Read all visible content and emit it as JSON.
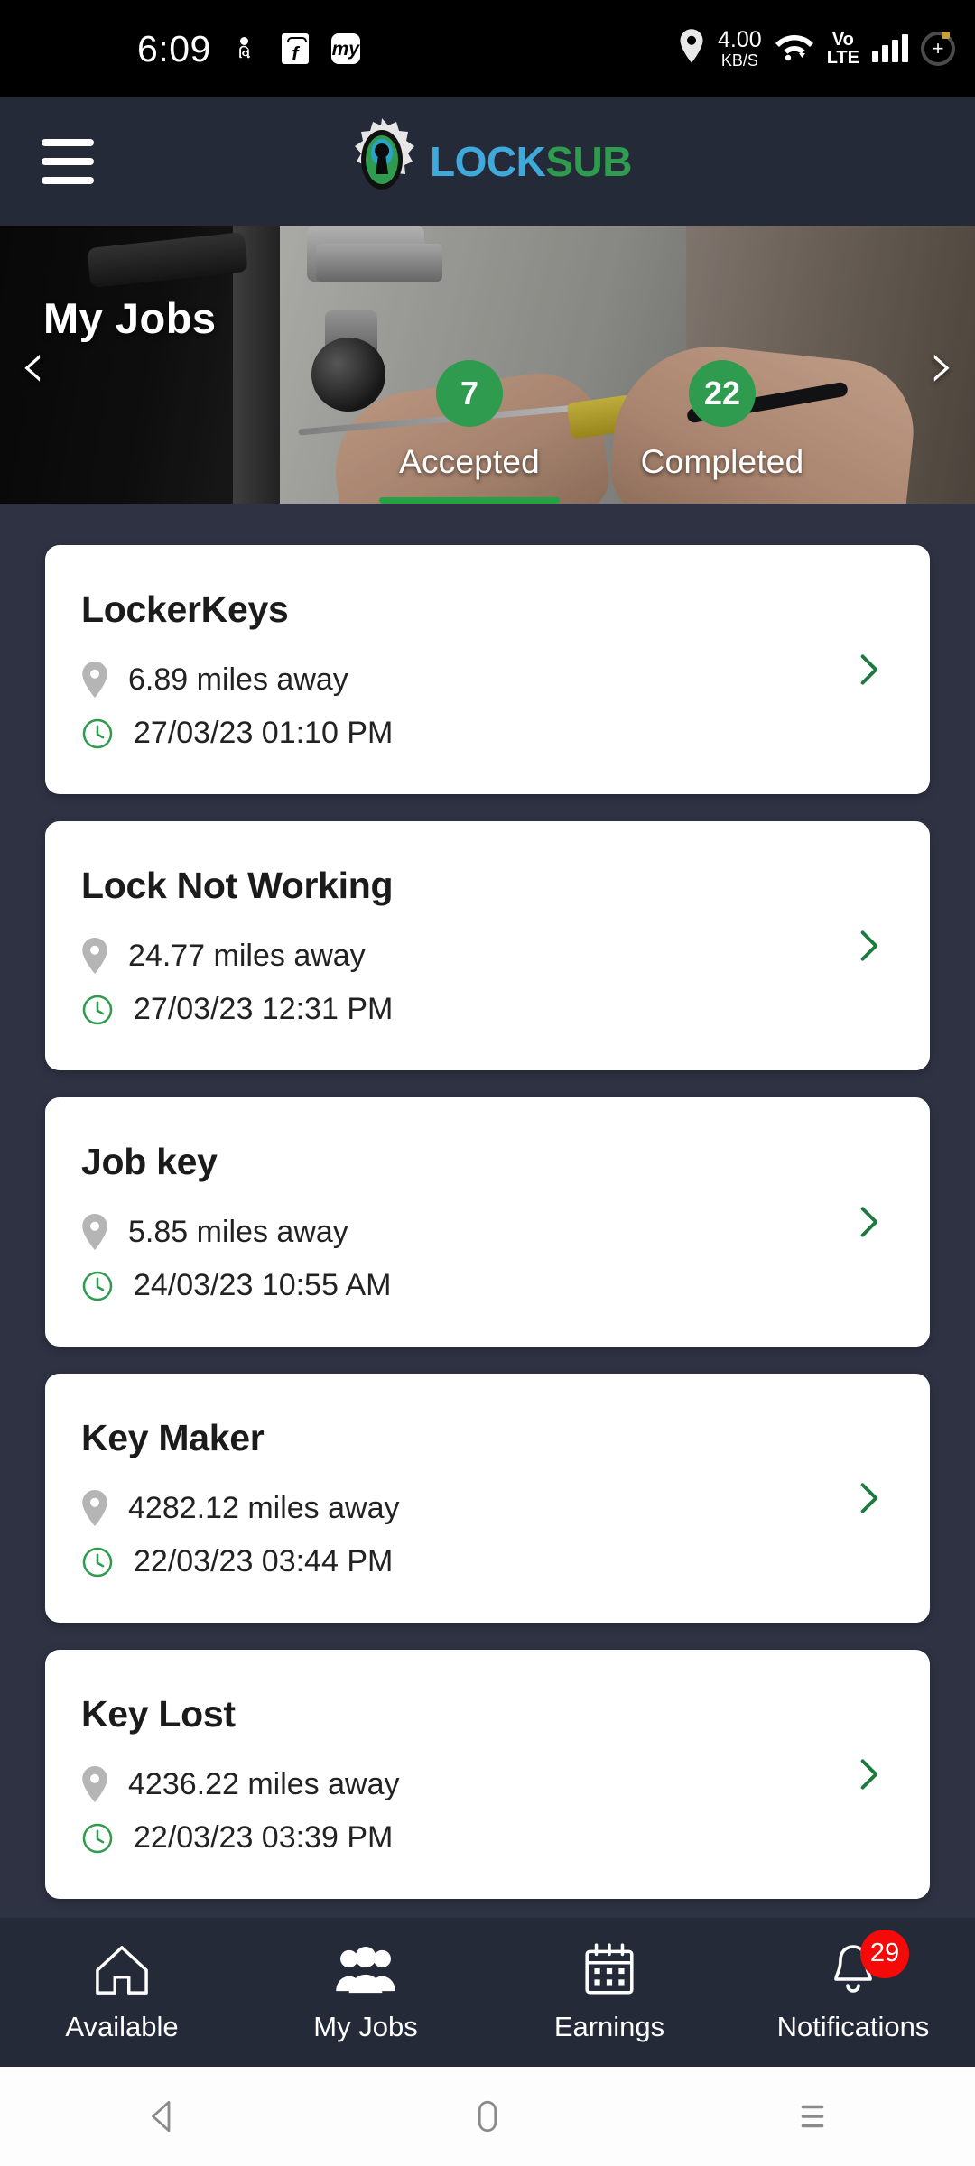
{
  "status_bar": {
    "time": "6:09",
    "left_icons": [
      "gujarati-news-icon",
      "flipkart-icon",
      "myjio-icon"
    ],
    "network_speed_value": "4.00",
    "network_speed_unit": "KB/S",
    "volte_line1": "Vo",
    "volte_line2": "LTE",
    "right_icons": [
      "location-pin-icon",
      "wifi-icon",
      "volte-icon",
      "signal-bars-icon",
      "battery-icon"
    ]
  },
  "app_bar": {
    "menu_icon": "hamburger-menu-icon",
    "brand_part1": "LOCK",
    "brand_part2": "SUB",
    "brand_color_1": "#3FA9DC",
    "brand_color_2": "#2E9B4E",
    "logo_icon": "gear-keyhole-logo"
  },
  "hero": {
    "title": "My Jobs",
    "prev_arrow": "‹",
    "next_arrow": "›",
    "tabs": [
      {
        "count": "7",
        "label": "Accepted",
        "active": true
      },
      {
        "count": "22",
        "label": "Completed",
        "active": false
      }
    ],
    "badge_color": "#2E9B4E",
    "active_underline_color": "#25A244"
  },
  "jobs": [
    {
      "title": "LockerKeys",
      "distance": "6.89 miles away",
      "datetime": "27/03/23 01:10 PM"
    },
    {
      "title": "Lock Not Working",
      "distance": "24.77 miles away",
      "datetime": "27/03/23 12:31 PM"
    },
    {
      "title": "Job key",
      "distance": "5.85 miles away",
      "datetime": "24/03/23 10:55 AM"
    },
    {
      "title": "Key Maker",
      "distance": "4282.12 miles away",
      "datetime": "22/03/23 03:44 PM"
    },
    {
      "title": "Key Lost",
      "distance": "4236.22 miles away",
      "datetime": "22/03/23 03:39 PM"
    }
  ],
  "bottom_nav": {
    "items": [
      {
        "label": "Available",
        "icon": "home-icon",
        "active": false,
        "badge": ""
      },
      {
        "label": "My Jobs",
        "icon": "people-group-icon",
        "active": true,
        "badge": ""
      },
      {
        "label": "Earnings",
        "icon": "calendar-icon",
        "active": false,
        "badge": ""
      },
      {
        "label": "Notifications",
        "icon": "bell-icon",
        "active": false,
        "badge": "29"
      }
    ],
    "badge_color": "#F50A0A"
  },
  "android_nav": {
    "back": "back-triangle-icon",
    "home": "home-square-icon",
    "recents": "recents-menu-icon"
  },
  "theme": {
    "page_background": "#2F3243",
    "bar_background": "#252A38",
    "card_background": "#FFFFFF",
    "accent_green": "#2E9B4E"
  }
}
